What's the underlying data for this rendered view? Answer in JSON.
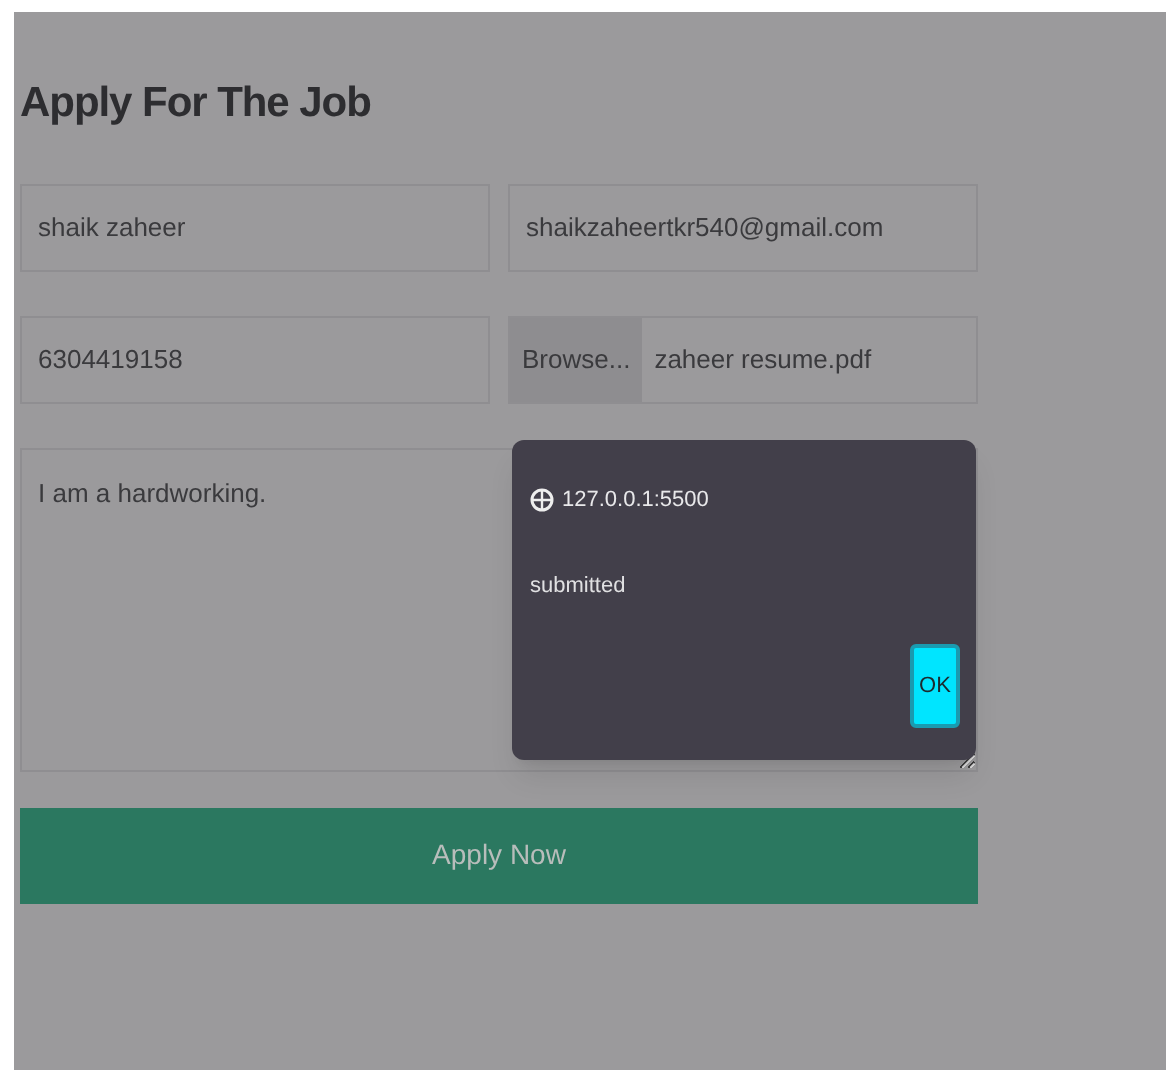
{
  "form": {
    "title": "Apply For The Job",
    "name": {
      "value": "shaik zaheer"
    },
    "email": {
      "value": "shaikzaheertkr540@gmail.com"
    },
    "phone": {
      "value": "6304419158"
    },
    "file": {
      "button": "Browse...",
      "value": "zaheer resume.pdf"
    },
    "message": {
      "value": "I am a hardworking."
    },
    "submit": "Apply Now"
  },
  "dialog": {
    "origin": "127.0.0.1:5500",
    "message": "submitted",
    "ok": "OK"
  }
}
